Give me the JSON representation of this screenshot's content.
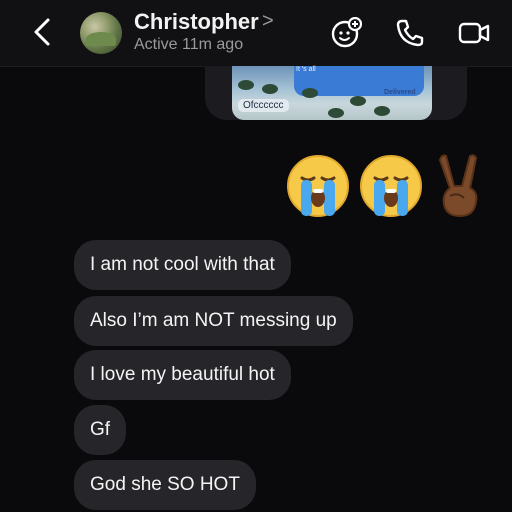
{
  "header": {
    "contact_name": "Christopher",
    "name_chevron": ">",
    "status": "Active 11m ago",
    "icons": [
      "back-chevron-icon",
      "games-icon",
      "phone-icon",
      "video-icon"
    ]
  },
  "shared_image": {
    "card_text": "It 's all",
    "delivered": "Delivered",
    "caption": "Ofcccccc"
  },
  "reactions": {
    "emojis": [
      "loudly-crying-face",
      "loudly-crying-face",
      "victory-hand"
    ]
  },
  "messages": [
    {
      "text": "I am not cool with that"
    },
    {
      "text": "Also I’m am NOT messing up"
    },
    {
      "text": "I love my beautiful hot"
    },
    {
      "text": "Gf"
    },
    {
      "text": "God she SO HOT"
    }
  ],
  "colors": {
    "background": "#0a0a0c",
    "received_bubble": "#26262a",
    "header_bg": "#111114",
    "muted_text": "#9a9a9a"
  }
}
